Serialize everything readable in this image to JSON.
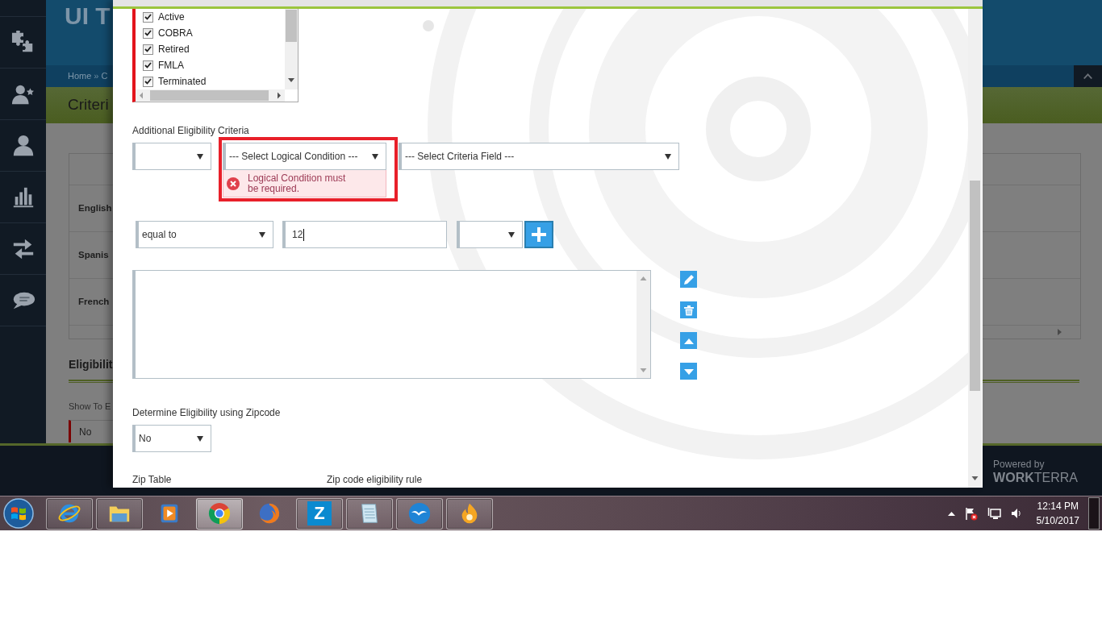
{
  "sidebar": {
    "items": [
      {
        "kind": "puzzle"
      },
      {
        "kind": "user_star"
      },
      {
        "kind": "user"
      },
      {
        "kind": "chart"
      },
      {
        "kind": "swap"
      },
      {
        "kind": "chat"
      }
    ]
  },
  "header": {
    "title": "UI T",
    "breadcrumb": {
      "items": [
        "Home",
        "C"
      ],
      "separators": [
        "»"
      ]
    }
  },
  "page_title": "Criteri",
  "languages_table": {
    "rows": [
      {
        "label": "English"
      },
      {
        "label": "Spanis"
      },
      {
        "label": "French"
      }
    ]
  },
  "eligibility_section": {
    "title": "Eligibilit",
    "field_label": "Show To E",
    "field_value": "No"
  },
  "footer": {
    "powered_by": "Powered by",
    "brand": "**WORK**TERRA"
  },
  "modal": {
    "status_list": {
      "items": [
        {
          "label": "Active",
          "checked": true
        },
        {
          "label": "COBRA",
          "checked": true
        },
        {
          "label": "Retired",
          "checked": true
        },
        {
          "label": "FMLA",
          "checked": true
        },
        {
          "label": "Terminated",
          "checked": true
        }
      ]
    },
    "criteria_label": "Additional Eligibility Criteria",
    "criteria_row": [
      {
        "kind": "select",
        "highlighted": false
      },
      {
        "kind": "select",
        "value": "--- Select Logical Condition ---",
        "highlighted": true,
        "error": "Logical Condition must be required."
      },
      {
        "kind": "select",
        "value": "--- Select Criteria Field ---",
        "highlighted": false
      }
    ],
    "condition_row": [
      {
        "kind": "select",
        "value": "equal to",
        "focused": false
      },
      {
        "kind": "input",
        "value": "12",
        "focused": true
      },
      {
        "kind": "select",
        "focused": false
      },
      {
        "kind": "add_button",
        "focused": false
      }
    ],
    "list_actions": [
      {
        "kind": "edit"
      },
      {
        "kind": "delete"
      },
      {
        "kind": "move_up"
      },
      {
        "kind": "move_down"
      }
    ],
    "zipcode": {
      "label": "Determine Eligibility using Zipcode",
      "value": "No"
    },
    "bottom_labels": [
      "Zip Table",
      "Zip code eligibility rule"
    ]
  },
  "taskbar": {
    "apps": [
      {
        "kind": "ringed_circle",
        "running": true,
        "selected": false
      },
      {
        "kind": "folder",
        "running": true,
        "selected": false
      },
      {
        "kind": "play",
        "running": false,
        "selected": false
      },
      {
        "kind": "segmented_circle",
        "running": true,
        "selected": true
      },
      {
        "kind": "globe",
        "running": false,
        "selected": false
      },
      {
        "kind": "letter",
        "letter": "Z",
        "running": true,
        "selected": false
      },
      {
        "kind": "notepad",
        "running": true,
        "selected": false
      },
      {
        "kind": "gulls",
        "running": true,
        "selected": false
      },
      {
        "kind": "flame",
        "running": true,
        "selected": false
      }
    ],
    "tray": {
      "icons": [
        {
          "kind": "caret_up"
        },
        {
          "kind": "flag_alert"
        },
        {
          "kind": "network"
        },
        {
          "kind": "speaker"
        }
      ]
    },
    "clock": {
      "time": "12:14 PM",
      "date": "5/10/2017"
    }
  }
}
